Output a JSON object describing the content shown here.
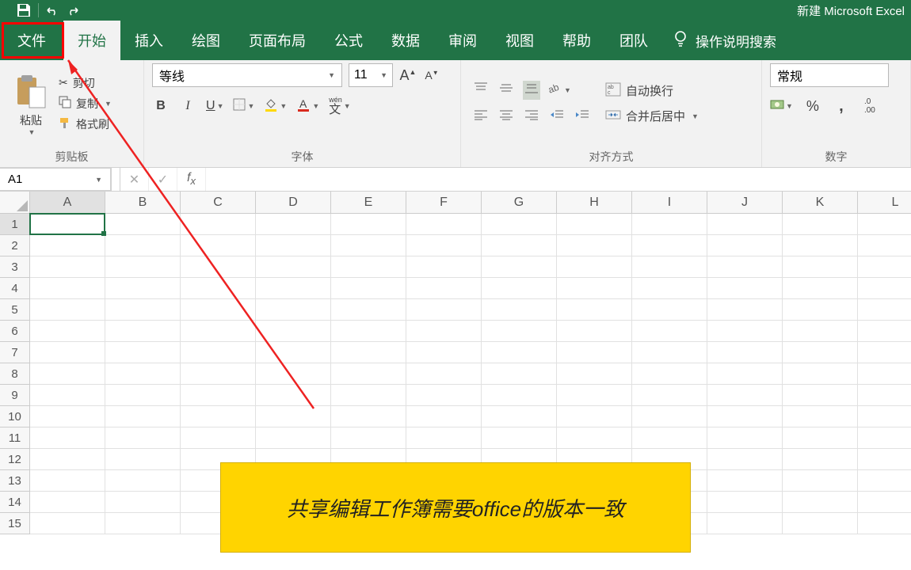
{
  "app": {
    "title": "新建 Microsoft Excel"
  },
  "tabs": {
    "file": "文件",
    "home": "开始",
    "insert": "插入",
    "draw": "绘图",
    "pagelayout": "页面布局",
    "formulas": "公式",
    "data": "数据",
    "review": "审阅",
    "view": "视图",
    "help": "帮助",
    "team": "团队",
    "tellme": "操作说明搜索"
  },
  "ribbon": {
    "clipboard": {
      "paste": "粘贴",
      "cut": "剪切",
      "copy": "复制",
      "formatpainter": "格式刷",
      "group": "剪贴板"
    },
    "font": {
      "name": "等线",
      "size": "11",
      "group": "字体"
    },
    "alignment": {
      "wrap": "自动换行",
      "merge": "合并后居中",
      "group": "对齐方式"
    },
    "number": {
      "format": "常规",
      "group": "数字"
    }
  },
  "formula_bar": {
    "namebox": "A1"
  },
  "grid": {
    "columns": [
      "A",
      "B",
      "C",
      "D",
      "E",
      "F",
      "G",
      "H",
      "I",
      "J",
      "K",
      "L"
    ],
    "rows": [
      1,
      2,
      3,
      4,
      5,
      6,
      7,
      8,
      9,
      10,
      11,
      12,
      13,
      14,
      15
    ],
    "selected": "A1"
  },
  "annotation": {
    "callout": "共享编辑工作簿需要office的版本一致"
  }
}
